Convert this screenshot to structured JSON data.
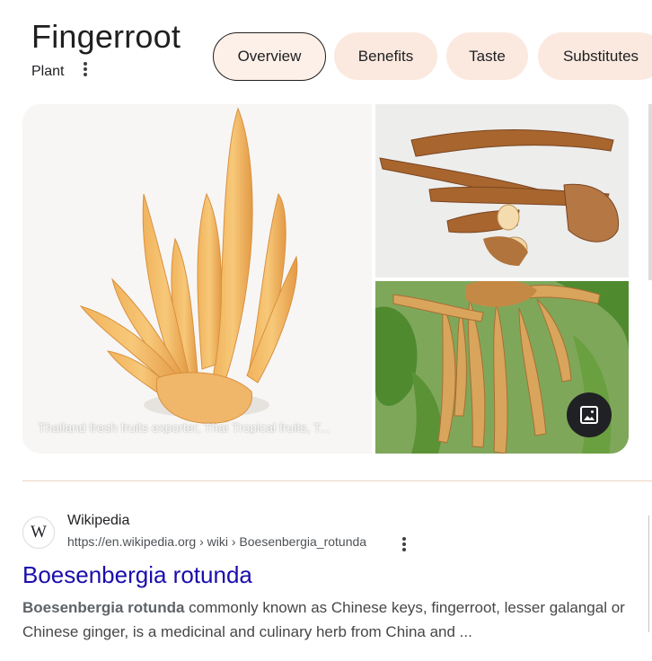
{
  "header": {
    "title": "Fingerroot",
    "subtitle": "Plant"
  },
  "tabs": [
    {
      "label": "Overview",
      "active": true
    },
    {
      "label": "Benefits",
      "active": false
    },
    {
      "label": "Taste",
      "active": false
    },
    {
      "label": "Substitutes",
      "active": false
    }
  ],
  "images": {
    "main_caption": "Thailand fresh fruits exporter, Thai Tropical fruits, T...",
    "gallery_icon": "image-icon"
  },
  "result": {
    "favicon_letter": "W",
    "source_name": "Wikipedia",
    "url": "https://en.wikipedia.org › wiki › Boesenbergia_rotunda",
    "title": "Boesenbergia rotunda",
    "snippet_bold": "Boesenbergia rotunda",
    "snippet_rest": " commonly known as Chinese keys, fingerroot, lesser galangal or Chinese ginger, is a medicinal and culinary herb from China and ..."
  },
  "colors": {
    "chip_bg": "#fbe9df",
    "link": "#1a0dab",
    "divider": "#ecd3c1"
  }
}
